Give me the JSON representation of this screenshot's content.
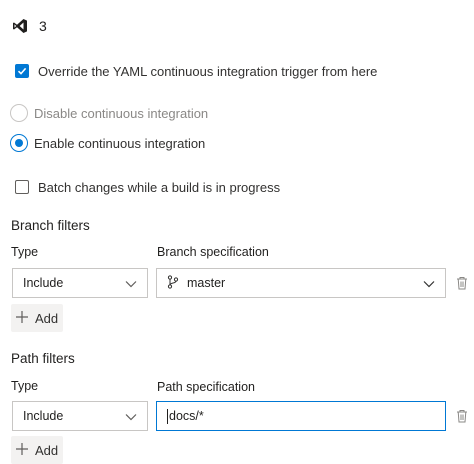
{
  "header": {
    "title": "3",
    "icon": "visual-studio-icon"
  },
  "override": {
    "label": "Override the YAML continuous integration trigger from here",
    "checked": true
  },
  "ci": {
    "disable_label": "Disable continuous integration",
    "enable_label": "Enable continuous integration",
    "selected": "enable"
  },
  "batch": {
    "label": "Batch changes while a build is in progress",
    "checked": false
  },
  "branch_filters": {
    "title": "Branch filters",
    "type_label": "Type",
    "spec_label": "Branch specification",
    "type_value": "Include",
    "spec_value": "master",
    "add_label": "Add"
  },
  "path_filters": {
    "title": "Path filters",
    "type_label": "Type",
    "spec_label": "Path specification",
    "type_value": "Include",
    "spec_value": "docs/*",
    "add_label": "Add"
  },
  "colors": {
    "accent": "#0078d4",
    "text": "#323130",
    "border": "#c8c6c4"
  }
}
